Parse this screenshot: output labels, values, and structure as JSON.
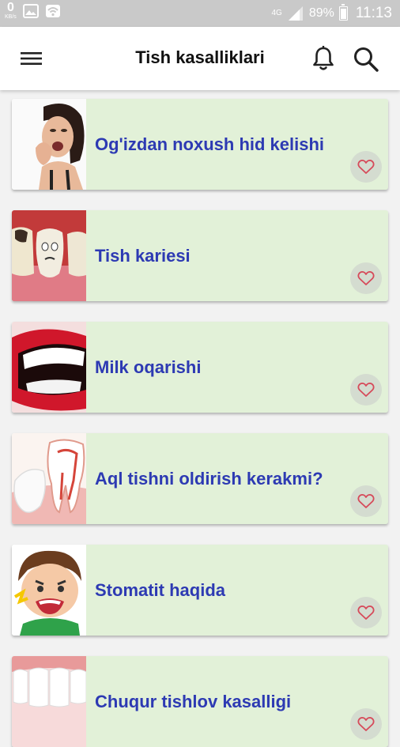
{
  "status_bar": {
    "net_speed_value": "0",
    "net_speed_unit": "KB/s",
    "network_type": "4G",
    "battery_percent": "89%",
    "time": "11:13"
  },
  "app_bar": {
    "title": "Tish kasalliklari",
    "menu_icon": "hamburger-menu-icon",
    "notification_icon": "bell-icon",
    "search_icon": "search-icon"
  },
  "articles": [
    {
      "title": "Og'izdan noxush hid kelishi"
    },
    {
      "title": "Tish kariesi"
    },
    {
      "title": "Milk oqarishi"
    },
    {
      "title": "Aql tishni oldirish kerakmi?"
    },
    {
      "title": "Stomatit haqida"
    },
    {
      "title": "Chuqur tishlov kasalligi"
    }
  ],
  "colors": {
    "card_background": "#e2f1d8",
    "card_title": "#2d3ab3",
    "heart": "#d64a5a",
    "status_bar": "#c9c9c9"
  }
}
